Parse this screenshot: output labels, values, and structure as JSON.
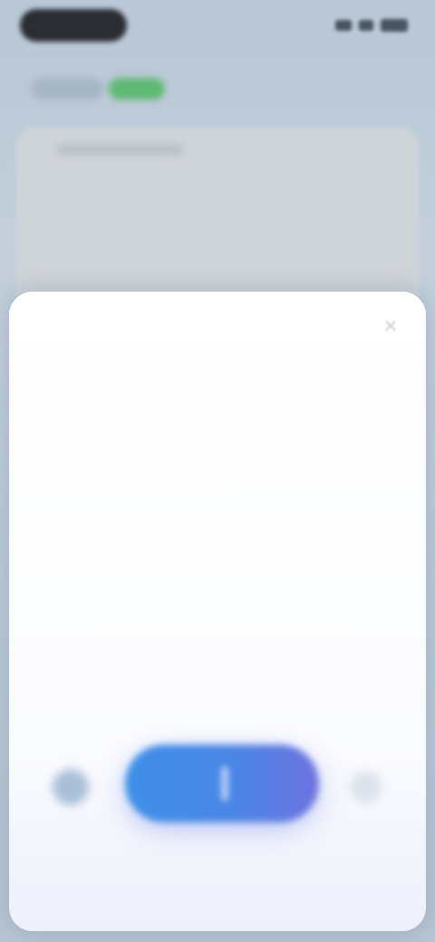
{
  "status_bar": {
    "time": "",
    "icons": [
      "signal-icon",
      "wifi-icon",
      "battery-icon"
    ]
  },
  "tabs": [
    {
      "label": ""
    },
    {
      "label": ""
    }
  ],
  "background_card": {
    "title": ""
  },
  "sheet": {
    "title": "",
    "subtitle": "",
    "description": "",
    "hint": "",
    "bottom_hint": "",
    "close_icon": "close-icon",
    "left_control_icon": "circle-button-icon",
    "right_control_icon": "circle-button-icon"
  },
  "colors": {
    "primary_gradient_start": "#3e8fe8",
    "primary_gradient_end": "#6d72e0",
    "accent_green": "#5eb973",
    "sheet_background": "#ffffff"
  }
}
